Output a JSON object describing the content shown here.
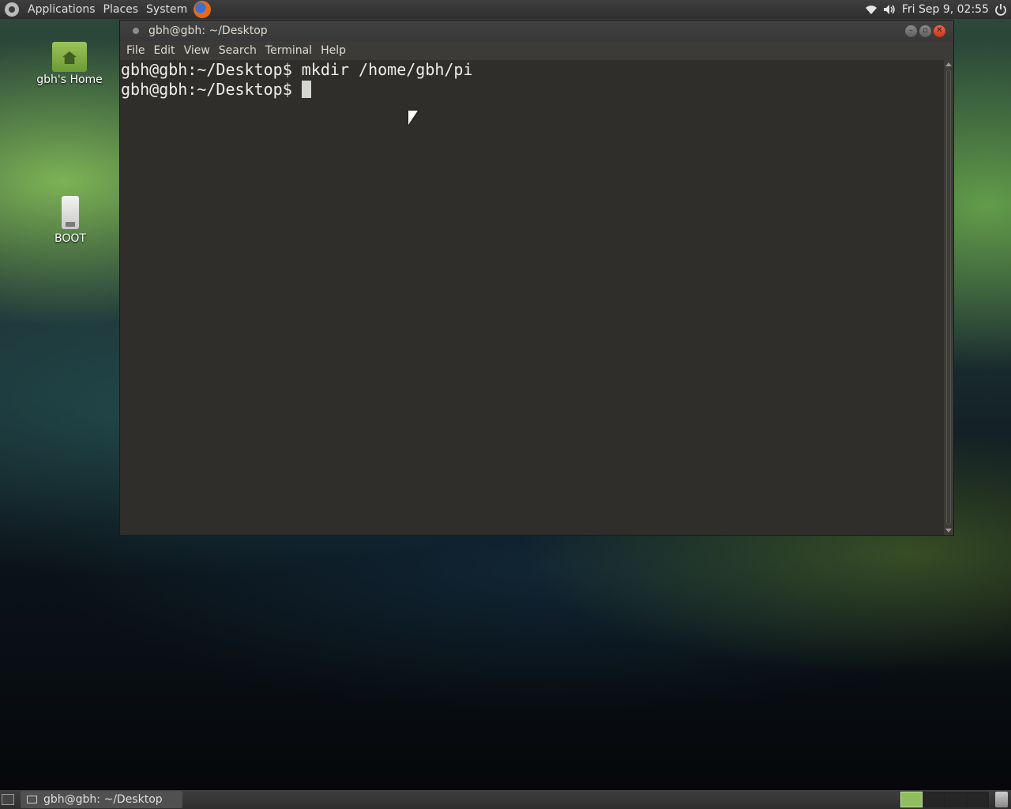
{
  "top_panel": {
    "menus": [
      "Applications",
      "Places",
      "System"
    ],
    "clock": "Fri Sep  9, 02:55",
    "icons": [
      "ubuntu-logo-icon",
      "firefox-icon",
      "wifi-icon",
      "volume-icon",
      "power-icon"
    ]
  },
  "desktop": {
    "icons": [
      {
        "label": "gbh's Home",
        "icon": "home-folder-icon"
      },
      {
        "label": "BOOT",
        "icon": "usb-drive-icon"
      }
    ]
  },
  "terminal": {
    "title": "gbh@gbh: ~/Desktop",
    "menu": [
      "File",
      "Edit",
      "View",
      "Search",
      "Terminal",
      "Help"
    ],
    "lines": [
      "gbh@gbh:~/Desktop$ mkdir /home/gbh/pi",
      "gbh@gbh:~/Desktop$ "
    ]
  },
  "bottom_panel": {
    "task_label": "gbh@gbh: ~/Desktop"
  },
  "colors": {
    "terminal_bg": "#2f2e2a",
    "terminal_fg": "#eeeeec",
    "close_button": "#e0502f",
    "panel_bg": "#363636",
    "active_workspace": "#8fbf5a"
  }
}
